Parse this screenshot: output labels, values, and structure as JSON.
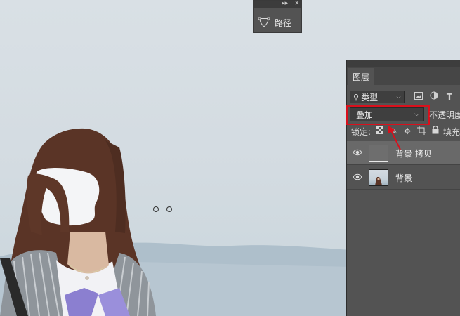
{
  "paths_panel": {
    "collapse_glyph": "▸▸",
    "close_glyph": "✕",
    "paths_label": "路径",
    "paths_icon": "path-icon"
  },
  "layers_panel": {
    "tab_label": "图层",
    "filter": {
      "icon": "search-icon",
      "value": "类型"
    },
    "filter_icons": [
      "image-filter-icon",
      "adjustment-filter-icon",
      "type-filter-icon"
    ],
    "blend_mode": "叠加",
    "opacity_label": "不透明度",
    "lock_label": "锁定:",
    "lock_icons": [
      "lock-transparent-icon",
      "lock-brush-icon",
      "lock-move-icon",
      "lock-artboard-icon",
      "lock-all-icon"
    ],
    "fill_label": "填充",
    "layers": [
      {
        "name": "背景 拷贝",
        "visible": true,
        "selected": true
      },
      {
        "name": "背景",
        "visible": true,
        "selected": false
      }
    ]
  },
  "colors": {
    "panel_bg": "#535353",
    "highlight_red": "#d9101c"
  }
}
